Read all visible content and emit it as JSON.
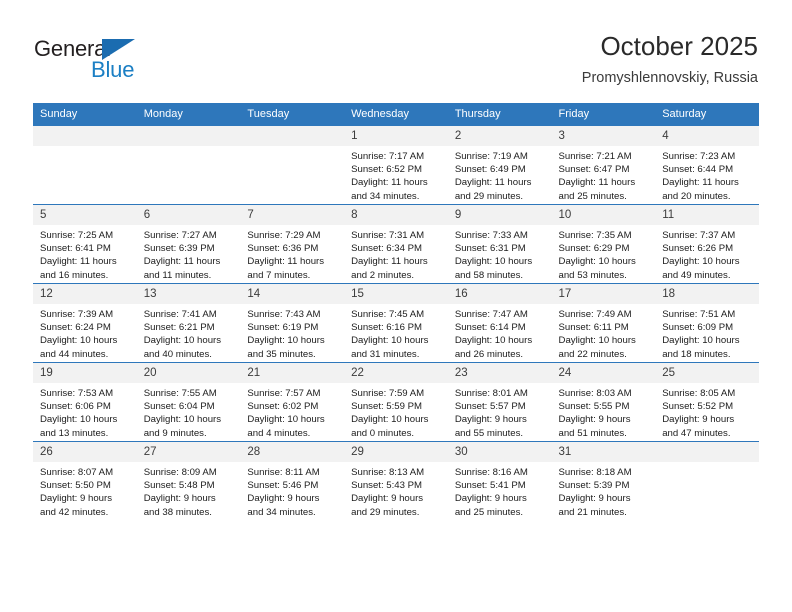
{
  "brand": {
    "name_top": "General",
    "name_bottom": "Blue",
    "triangle_icon": "blue-triangle-logo-mark",
    "color_top": "#231f20",
    "color_bottom": "#1b7fc4",
    "accent": "#2e77bb"
  },
  "header": {
    "title": "October 2025",
    "subtitle": "Promyshlennovskiy, Russia"
  },
  "calendar": {
    "weekday_headers": [
      "Sunday",
      "Monday",
      "Tuesday",
      "Wednesday",
      "Thursday",
      "Friday",
      "Saturday"
    ],
    "header_bg": "#2e77bb",
    "daynum_bg": "#f2f2f2",
    "weeks": [
      [
        {
          "day": "",
          "empty": true
        },
        {
          "day": "",
          "empty": true
        },
        {
          "day": "",
          "empty": true
        },
        {
          "day": "1",
          "sunrise": "Sunrise: 7:17 AM",
          "sunset": "Sunset: 6:52 PM",
          "daylight_line1": "Daylight: 11 hours",
          "daylight_line2": "and 34 minutes."
        },
        {
          "day": "2",
          "sunrise": "Sunrise: 7:19 AM",
          "sunset": "Sunset: 6:49 PM",
          "daylight_line1": "Daylight: 11 hours",
          "daylight_line2": "and 29 minutes."
        },
        {
          "day": "3",
          "sunrise": "Sunrise: 7:21 AM",
          "sunset": "Sunset: 6:47 PM",
          "daylight_line1": "Daylight: 11 hours",
          "daylight_line2": "and 25 minutes."
        },
        {
          "day": "4",
          "sunrise": "Sunrise: 7:23 AM",
          "sunset": "Sunset: 6:44 PM",
          "daylight_line1": "Daylight: 11 hours",
          "daylight_line2": "and 20 minutes."
        }
      ],
      [
        {
          "day": "5",
          "sunrise": "Sunrise: 7:25 AM",
          "sunset": "Sunset: 6:41 PM",
          "daylight_line1": "Daylight: 11 hours",
          "daylight_line2": "and 16 minutes."
        },
        {
          "day": "6",
          "sunrise": "Sunrise: 7:27 AM",
          "sunset": "Sunset: 6:39 PM",
          "daylight_line1": "Daylight: 11 hours",
          "daylight_line2": "and 11 minutes."
        },
        {
          "day": "7",
          "sunrise": "Sunrise: 7:29 AM",
          "sunset": "Sunset: 6:36 PM",
          "daylight_line1": "Daylight: 11 hours",
          "daylight_line2": "and 7 minutes."
        },
        {
          "day": "8",
          "sunrise": "Sunrise: 7:31 AM",
          "sunset": "Sunset: 6:34 PM",
          "daylight_line1": "Daylight: 11 hours",
          "daylight_line2": "and 2 minutes."
        },
        {
          "day": "9",
          "sunrise": "Sunrise: 7:33 AM",
          "sunset": "Sunset: 6:31 PM",
          "daylight_line1": "Daylight: 10 hours",
          "daylight_line2": "and 58 minutes."
        },
        {
          "day": "10",
          "sunrise": "Sunrise: 7:35 AM",
          "sunset": "Sunset: 6:29 PM",
          "daylight_line1": "Daylight: 10 hours",
          "daylight_line2": "and 53 minutes."
        },
        {
          "day": "11",
          "sunrise": "Sunrise: 7:37 AM",
          "sunset": "Sunset: 6:26 PM",
          "daylight_line1": "Daylight: 10 hours",
          "daylight_line2": "and 49 minutes."
        }
      ],
      [
        {
          "day": "12",
          "sunrise": "Sunrise: 7:39 AM",
          "sunset": "Sunset: 6:24 PM",
          "daylight_line1": "Daylight: 10 hours",
          "daylight_line2": "and 44 minutes."
        },
        {
          "day": "13",
          "sunrise": "Sunrise: 7:41 AM",
          "sunset": "Sunset: 6:21 PM",
          "daylight_line1": "Daylight: 10 hours",
          "daylight_line2": "and 40 minutes."
        },
        {
          "day": "14",
          "sunrise": "Sunrise: 7:43 AM",
          "sunset": "Sunset: 6:19 PM",
          "daylight_line1": "Daylight: 10 hours",
          "daylight_line2": "and 35 minutes."
        },
        {
          "day": "15",
          "sunrise": "Sunrise: 7:45 AM",
          "sunset": "Sunset: 6:16 PM",
          "daylight_line1": "Daylight: 10 hours",
          "daylight_line2": "and 31 minutes."
        },
        {
          "day": "16",
          "sunrise": "Sunrise: 7:47 AM",
          "sunset": "Sunset: 6:14 PM",
          "daylight_line1": "Daylight: 10 hours",
          "daylight_line2": "and 26 minutes."
        },
        {
          "day": "17",
          "sunrise": "Sunrise: 7:49 AM",
          "sunset": "Sunset: 6:11 PM",
          "daylight_line1": "Daylight: 10 hours",
          "daylight_line2": "and 22 minutes."
        },
        {
          "day": "18",
          "sunrise": "Sunrise: 7:51 AM",
          "sunset": "Sunset: 6:09 PM",
          "daylight_line1": "Daylight: 10 hours",
          "daylight_line2": "and 18 minutes."
        }
      ],
      [
        {
          "day": "19",
          "sunrise": "Sunrise: 7:53 AM",
          "sunset": "Sunset: 6:06 PM",
          "daylight_line1": "Daylight: 10 hours",
          "daylight_line2": "and 13 minutes."
        },
        {
          "day": "20",
          "sunrise": "Sunrise: 7:55 AM",
          "sunset": "Sunset: 6:04 PM",
          "daylight_line1": "Daylight: 10 hours",
          "daylight_line2": "and 9 minutes."
        },
        {
          "day": "21",
          "sunrise": "Sunrise: 7:57 AM",
          "sunset": "Sunset: 6:02 PM",
          "daylight_line1": "Daylight: 10 hours",
          "daylight_line2": "and 4 minutes."
        },
        {
          "day": "22",
          "sunrise": "Sunrise: 7:59 AM",
          "sunset": "Sunset: 5:59 PM",
          "daylight_line1": "Daylight: 10 hours",
          "daylight_line2": "and 0 minutes."
        },
        {
          "day": "23",
          "sunrise": "Sunrise: 8:01 AM",
          "sunset": "Sunset: 5:57 PM",
          "daylight_line1": "Daylight: 9 hours",
          "daylight_line2": "and 55 minutes."
        },
        {
          "day": "24",
          "sunrise": "Sunrise: 8:03 AM",
          "sunset": "Sunset: 5:55 PM",
          "daylight_line1": "Daylight: 9 hours",
          "daylight_line2": "and 51 minutes."
        },
        {
          "day": "25",
          "sunrise": "Sunrise: 8:05 AM",
          "sunset": "Sunset: 5:52 PM",
          "daylight_line1": "Daylight: 9 hours",
          "daylight_line2": "and 47 minutes."
        }
      ],
      [
        {
          "day": "26",
          "sunrise": "Sunrise: 8:07 AM",
          "sunset": "Sunset: 5:50 PM",
          "daylight_line1": "Daylight: 9 hours",
          "daylight_line2": "and 42 minutes."
        },
        {
          "day": "27",
          "sunrise": "Sunrise: 8:09 AM",
          "sunset": "Sunset: 5:48 PM",
          "daylight_line1": "Daylight: 9 hours",
          "daylight_line2": "and 38 minutes."
        },
        {
          "day": "28",
          "sunrise": "Sunrise: 8:11 AM",
          "sunset": "Sunset: 5:46 PM",
          "daylight_line1": "Daylight: 9 hours",
          "daylight_line2": "and 34 minutes."
        },
        {
          "day": "29",
          "sunrise": "Sunrise: 8:13 AM",
          "sunset": "Sunset: 5:43 PM",
          "daylight_line1": "Daylight: 9 hours",
          "daylight_line2": "and 29 minutes."
        },
        {
          "day": "30",
          "sunrise": "Sunrise: 8:16 AM",
          "sunset": "Sunset: 5:41 PM",
          "daylight_line1": "Daylight: 9 hours",
          "daylight_line2": "and 25 minutes."
        },
        {
          "day": "31",
          "sunrise": "Sunrise: 8:18 AM",
          "sunset": "Sunset: 5:39 PM",
          "daylight_line1": "Daylight: 9 hours",
          "daylight_line2": "and 21 minutes."
        },
        {
          "day": "",
          "empty": true
        }
      ]
    ]
  }
}
